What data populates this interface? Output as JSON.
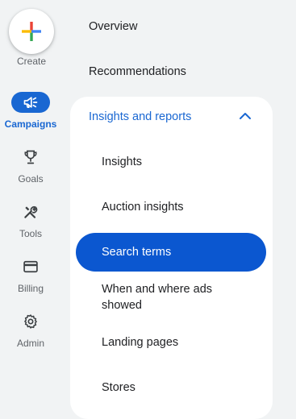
{
  "rail": {
    "create_label": "Create",
    "items": [
      {
        "label": "Campaigns",
        "icon": "campaigns-megaphone-icon",
        "active": true
      },
      {
        "label": "Goals",
        "icon": "trophy-icon",
        "active": false
      },
      {
        "label": "Tools",
        "icon": "tools-icon",
        "active": false
      },
      {
        "label": "Billing",
        "icon": "credit-card-icon",
        "active": false
      },
      {
        "label": "Admin",
        "icon": "gear-icon",
        "active": false
      }
    ]
  },
  "nav": {
    "overview": "Overview",
    "recommendations": "Recommendations",
    "section": {
      "title": "Insights and reports",
      "expanded": true,
      "items": [
        {
          "label": "Insights"
        },
        {
          "label": "Auction insights"
        },
        {
          "label": "Search terms",
          "selected": true
        },
        {
          "label": "When and where ads showed"
        },
        {
          "label": "Landing pages"
        },
        {
          "label": "Stores"
        }
      ]
    }
  },
  "colors": {
    "accent": "#1967d2",
    "selected_bg": "#0b57d0",
    "page_bg": "#f1f3f4",
    "text": "#202124",
    "muted": "#5f6368"
  }
}
